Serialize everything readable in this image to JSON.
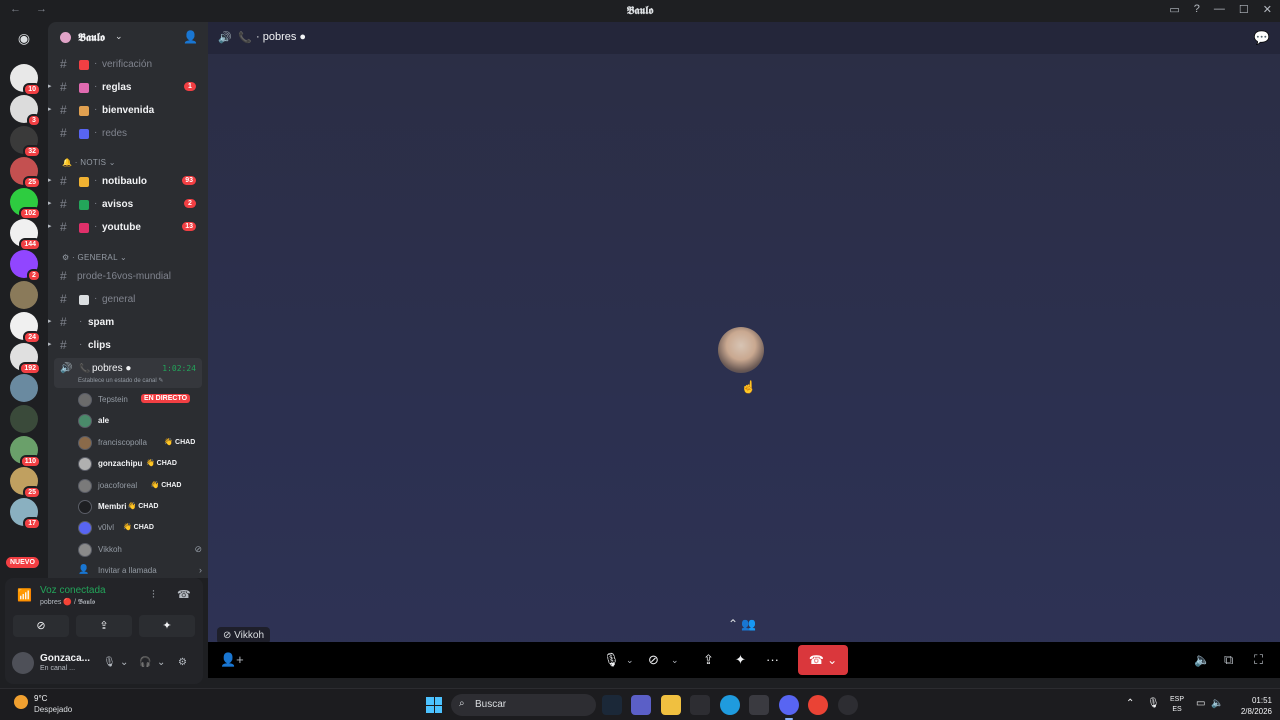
{
  "window": {
    "title": "𝕭𝖆𝖚𝖑𝖔",
    "nav": "← →"
  },
  "rail": {
    "servers": [
      {
        "badge": "10",
        "color": "#e8e8e8"
      },
      {
        "badge": "3",
        "color": "#dcdcdc"
      },
      {
        "badge": "32",
        "color": "#3a3a3a"
      },
      {
        "badge": "25",
        "color": "#c45050"
      },
      {
        "badge": "102",
        "color": "#2ecc40"
      },
      {
        "badge": "144",
        "color": "#f0f0f0"
      },
      {
        "badge": "2",
        "color": "#9146ff"
      },
      {
        "badge": "",
        "color": "#8a7a5a"
      },
      {
        "badge": "24",
        "color": "#f0f0f0"
      },
      {
        "badge": "192",
        "color": "#e0e0e0"
      },
      {
        "badge": "",
        "color": "#6a8aa0"
      },
      {
        "badge": "",
        "color": "#3a4a3a"
      },
      {
        "badge": "110",
        "color": "#6aa06a"
      },
      {
        "badge": "25",
        "color": "#c0a060"
      },
      {
        "badge": "17",
        "color": "#8ab0c0"
      }
    ],
    "nuevo_label": "NUEVO"
  },
  "guild": {
    "name": "𝕭𝖆𝖚𝖑𝖔"
  },
  "channels": [
    {
      "name": "verificación",
      "unread": false,
      "emoji_color": "#f23f43",
      "badge": "",
      "arrow": false
    },
    {
      "name": "reglas",
      "unread": true,
      "emoji_color": "#e06ab0",
      "badge": "1",
      "arrow": true
    },
    {
      "name": "bienvenida",
      "unread": true,
      "emoji_color": "#e0a050",
      "badge": "",
      "arrow": true
    },
    {
      "name": "redes",
      "unread": false,
      "emoji_color": "#5865f2",
      "badge": "",
      "arrow": false
    }
  ],
  "cat_notis": "NOTIS",
  "channels_notis": [
    {
      "name": "notibaulo",
      "unread": true,
      "emoji_color": "#f0b232",
      "badge": "93",
      "arrow": true
    },
    {
      "name": "avisos",
      "unread": true,
      "emoji_color": "#23a55a",
      "badge": "2",
      "arrow": true
    },
    {
      "name": "youtube",
      "unread": true,
      "emoji_color": "#e0306a",
      "badge": "13",
      "arrow": true
    }
  ],
  "cat_general": "GENERAL",
  "channels_general": [
    {
      "name": "prode-16vos-mundial",
      "unread": false,
      "emoji_color": "",
      "badge": "",
      "arrow": false
    },
    {
      "name": "general",
      "unread": false,
      "emoji_color": "#dbdee1",
      "badge": "",
      "arrow": false
    },
    {
      "name": "spam",
      "unread": true,
      "emoji_color": "",
      "badge": "",
      "arrow": true
    },
    {
      "name": "clips",
      "unread": true,
      "emoji_color": "",
      "badge": "",
      "arrow": true
    }
  ],
  "voice_channel": {
    "name": "pobres",
    "time": "1:02:24",
    "status": "Establece un estado de canal ✎"
  },
  "members": [
    {
      "name": "Tepstein",
      "live": "EN DIRECTO",
      "tag": "",
      "bright": false,
      "color": "#6b6b6b"
    },
    {
      "name": "ale",
      "live": "",
      "tag": "",
      "bright": true,
      "color": "#4a8a6a"
    },
    {
      "name": "franciscopolla",
      "live": "",
      "tag": "👋 CHAD",
      "bright": false,
      "color": "#8a6a4a"
    },
    {
      "name": "gonzachipu",
      "live": "",
      "tag": "👋 CHAD",
      "bright": true,
      "color": "#b0b0b0"
    },
    {
      "name": "joacoforeal",
      "live": "",
      "tag": "👋 CHAD",
      "bright": false,
      "color": "#7a7a7a"
    },
    {
      "name": "Membri",
      "live": "",
      "tag": "👋 CHAD",
      "bright": true,
      "color": "#1e1f22"
    },
    {
      "name": "v0lvl",
      "live": "",
      "tag": "👋 CHAD",
      "bright": false,
      "color": "#5865f2"
    },
    {
      "name": "Vikkoh",
      "live": "",
      "tag": "",
      "bright": false,
      "color": "#8a8a8a"
    }
  ],
  "invite_label": "Invitar a llamada",
  "voice_panel": {
    "connected": "Voz conectada",
    "location": "pobres 🔴 / 𝕭𝖆𝖚𝖑𝖔"
  },
  "user": {
    "name": "Gonzaca...",
    "status": "En canal ..."
  },
  "main": {
    "channel": "pobres",
    "speaker_tag": "Vikkoh"
  },
  "taskbar": {
    "temp": "9°C",
    "weather": "Despejado",
    "search_placeholder": "Buscar",
    "lang_1": "ESP",
    "lang_2": "ES",
    "time": "01:51",
    "date": "2/8/2026"
  }
}
